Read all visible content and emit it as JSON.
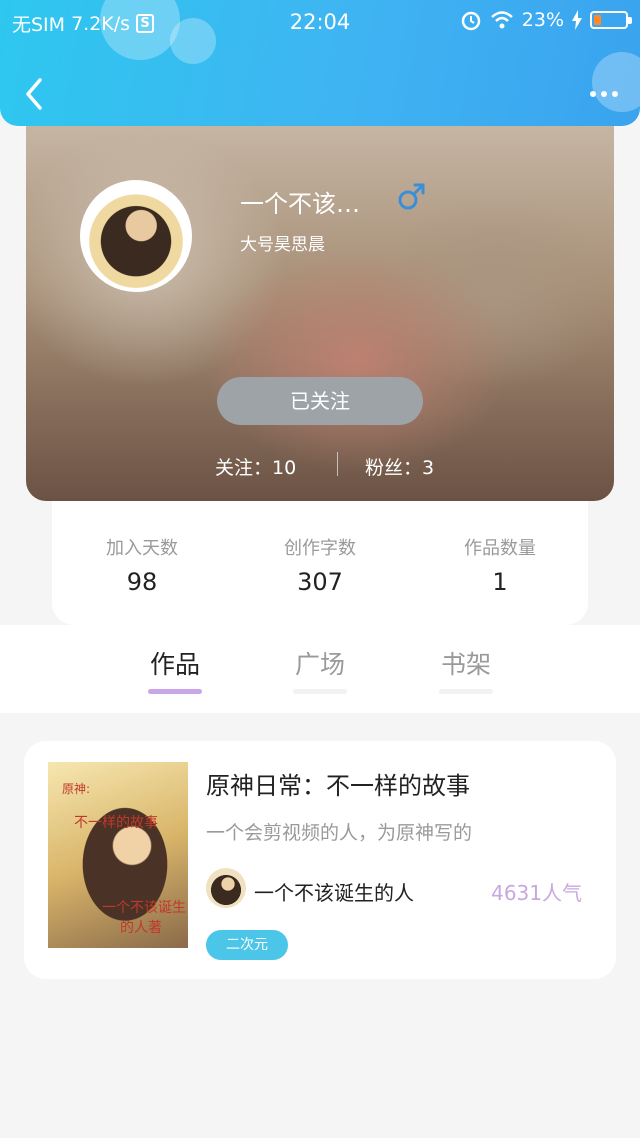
{
  "status_bar": {
    "carrier": "无SIM",
    "speed": "7.2K/s",
    "sim_icon_text": "S",
    "time": "22:04",
    "battery": "23%",
    "battery_level": 0.23
  },
  "header": {
    "back_icon": "chevron-left-icon",
    "more_icon": "more-dots-icon"
  },
  "profile": {
    "nickname": "一个不该…",
    "gender_icon": "male-icon",
    "subtitle": "大号昊思晨",
    "follow_button": "已关注",
    "following": "关注：10",
    "fans": "粉丝：3"
  },
  "stats": [
    {
      "label": "加入天数",
      "value": "98"
    },
    {
      "label": "创作字数",
      "value": "307"
    },
    {
      "label": "作品数量",
      "value": "1"
    }
  ],
  "tabs": [
    {
      "label": "作品",
      "active": true
    },
    {
      "label": "广场",
      "active": false
    },
    {
      "label": "书架",
      "active": false
    }
  ],
  "work": {
    "title": "原神日常：不一样的故事",
    "description": "一个会剪视频的人，为原神写的",
    "author": "一个不该诞生的人",
    "popularity": "4631人气",
    "tag": "二次元",
    "cover_text": {
      "line1": "原神:",
      "line2": "不一样的故事",
      "line3": "一个不该诞生",
      "line4": "的人著"
    }
  },
  "colors": {
    "header_gradient_start": "#2ec7ef",
    "header_gradient_end": "#3aa3ef",
    "active_tab_indicator": "#c9a6e8",
    "tag_bg": "#4cc6e8",
    "popularity": "#c7a8e0",
    "male_icon": "#3a8fd6"
  }
}
